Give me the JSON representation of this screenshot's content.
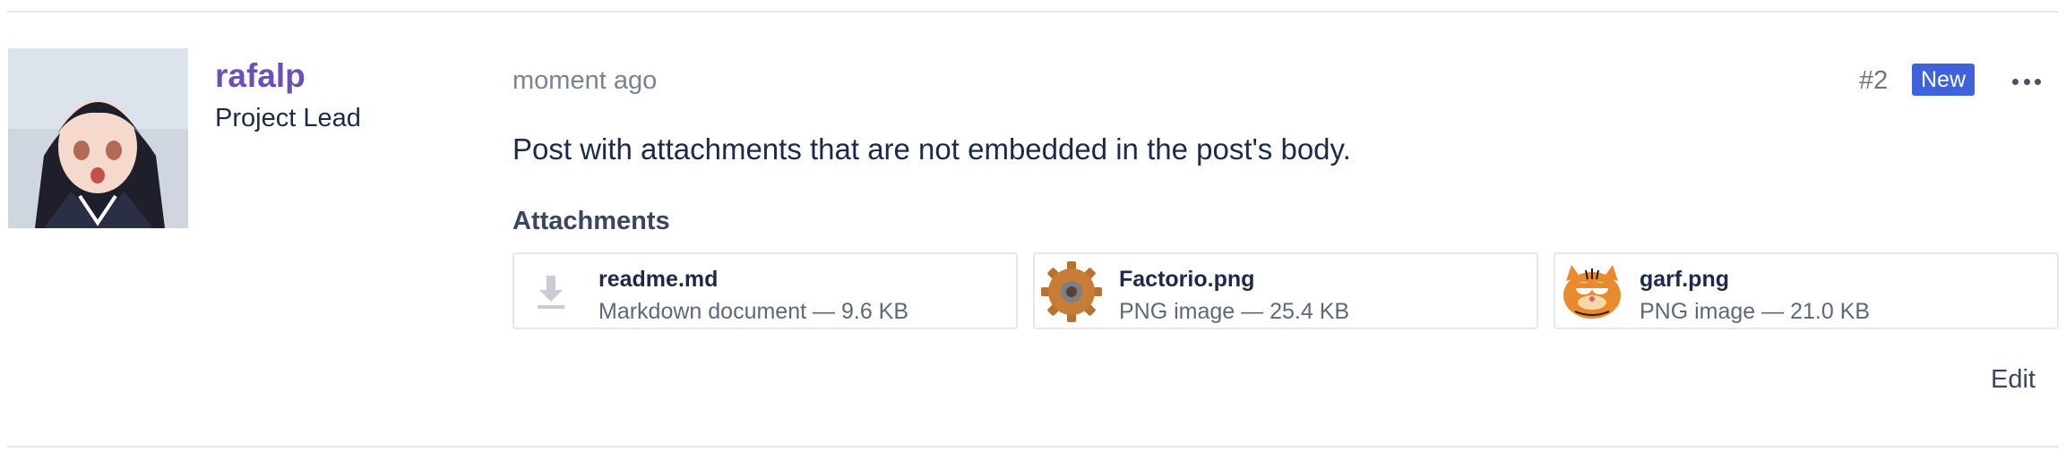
{
  "post": {
    "author": {
      "username": "rafalp",
      "title": "Project Lead"
    },
    "timestamp": "moment ago",
    "number": "#2",
    "badge": "New",
    "body": "Post with attachments that are not embedded in the post's body.",
    "attachments_heading": "Attachments",
    "attachments": [
      {
        "name": "readme.md",
        "type": "Markdown document",
        "size": "9.6 KB",
        "icon": "download-icon",
        "sep": "—"
      },
      {
        "name": "Factorio.png",
        "type": "PNG image",
        "size": "25.4 KB",
        "icon": "factorio-gear-thumbnail",
        "sep": "—"
      },
      {
        "name": "garf.png",
        "type": "PNG image",
        "size": "21.0 KB",
        "icon": "garfield-thumbnail",
        "sep": "—"
      }
    ],
    "edit_label": "Edit"
  },
  "colors": {
    "username": "#6b4fbb",
    "badge": "#3d62dc",
    "text": "#1c2a4a",
    "muted": "#7a8392"
  }
}
